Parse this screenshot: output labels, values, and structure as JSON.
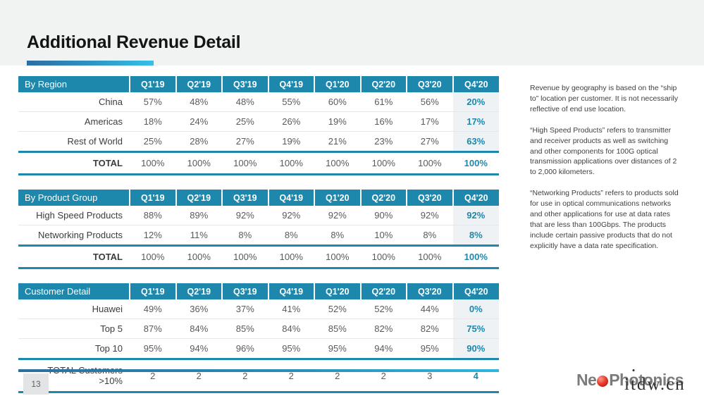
{
  "header": {
    "title": "Additional Revenue Detail"
  },
  "quarters": [
    "Q1'19",
    "Q2'19",
    "Q3'19",
    "Q4'19",
    "Q1'20",
    "Q2'20",
    "Q3'20",
    "Q4'20"
  ],
  "tables": [
    {
      "id": "by-region",
      "header_label": "By Region",
      "rows": [
        {
          "label": "China",
          "values": [
            "57%",
            "48%",
            "48%",
            "55%",
            "60%",
            "61%",
            "56%",
            "20%"
          ]
        },
        {
          "label": "Americas",
          "values": [
            "18%",
            "24%",
            "25%",
            "26%",
            "19%",
            "16%",
            "17%",
            "17%"
          ]
        },
        {
          "label": "Rest of World",
          "values": [
            "25%",
            "28%",
            "27%",
            "19%",
            "21%",
            "23%",
            "27%",
            "63%"
          ]
        }
      ],
      "total": {
        "label": "TOTAL",
        "values": [
          "100%",
          "100%",
          "100%",
          "100%",
          "100%",
          "100%",
          "100%",
          "100%"
        ]
      }
    },
    {
      "id": "by-product-group",
      "header_label": "By Product Group",
      "rows": [
        {
          "label": "High Speed Products",
          "values": [
            "88%",
            "89%",
            "92%",
            "92%",
            "92%",
            "90%",
            "92%",
            "92%"
          ]
        },
        {
          "label": "Networking Products",
          "values": [
            "12%",
            "11%",
            "8%",
            "8%",
            "8%",
            "10%",
            "8%",
            "8%"
          ]
        }
      ],
      "total": {
        "label": "TOTAL",
        "values": [
          "100%",
          "100%",
          "100%",
          "100%",
          "100%",
          "100%",
          "100%",
          "100%"
        ]
      }
    },
    {
      "id": "customer-detail",
      "header_label": "Customer Detail",
      "rows": [
        {
          "label": "Huawei",
          "values": [
            "49%",
            "36%",
            "37%",
            "41%",
            "52%",
            "52%",
            "44%",
            "0%"
          ]
        },
        {
          "label": "Top 5",
          "values": [
            "87%",
            "84%",
            "85%",
            "84%",
            "85%",
            "82%",
            "82%",
            "75%"
          ]
        },
        {
          "label": "Top 10",
          "values": [
            "95%",
            "94%",
            "96%",
            "95%",
            "95%",
            "94%",
            "95%",
            "90%"
          ]
        }
      ],
      "total": {
        "label_line1": "TOTAL Customers",
        "label_line2": ">10%",
        "values": [
          "2",
          "2",
          "2",
          "2",
          "2",
          "2",
          "3",
          "4"
        ]
      }
    }
  ],
  "notes": [
    "Revenue by geography is based on the “ship to” location per customer.  It is not necessarily reflective of end use location.",
    "“High Speed Products” refers to transmitter and receiver products as well as switching and other components for 100G optical transmission applications over distances of 2 to 2,000 kilometers.",
    "“Networking Products” refers to products sold for use in optical communications networks and other applications for use at data rates that are less than 100Gbps.  The products include certain passive products that do not explicitly have a data rate specification."
  ],
  "footer": {
    "page_number": "13",
    "logo": {
      "prefix": "Ne",
      "suffix_a": "Ph",
      "suffix_o": "o",
      "suffix_b": "tonics"
    },
    "watermark": "itdw.cn"
  },
  "colors": {
    "header_teal": "#1d87ac",
    "highlight_bg": "#eef2f4",
    "band_gray": "#f1f2f2",
    "logo_red": "#e8392a"
  }
}
